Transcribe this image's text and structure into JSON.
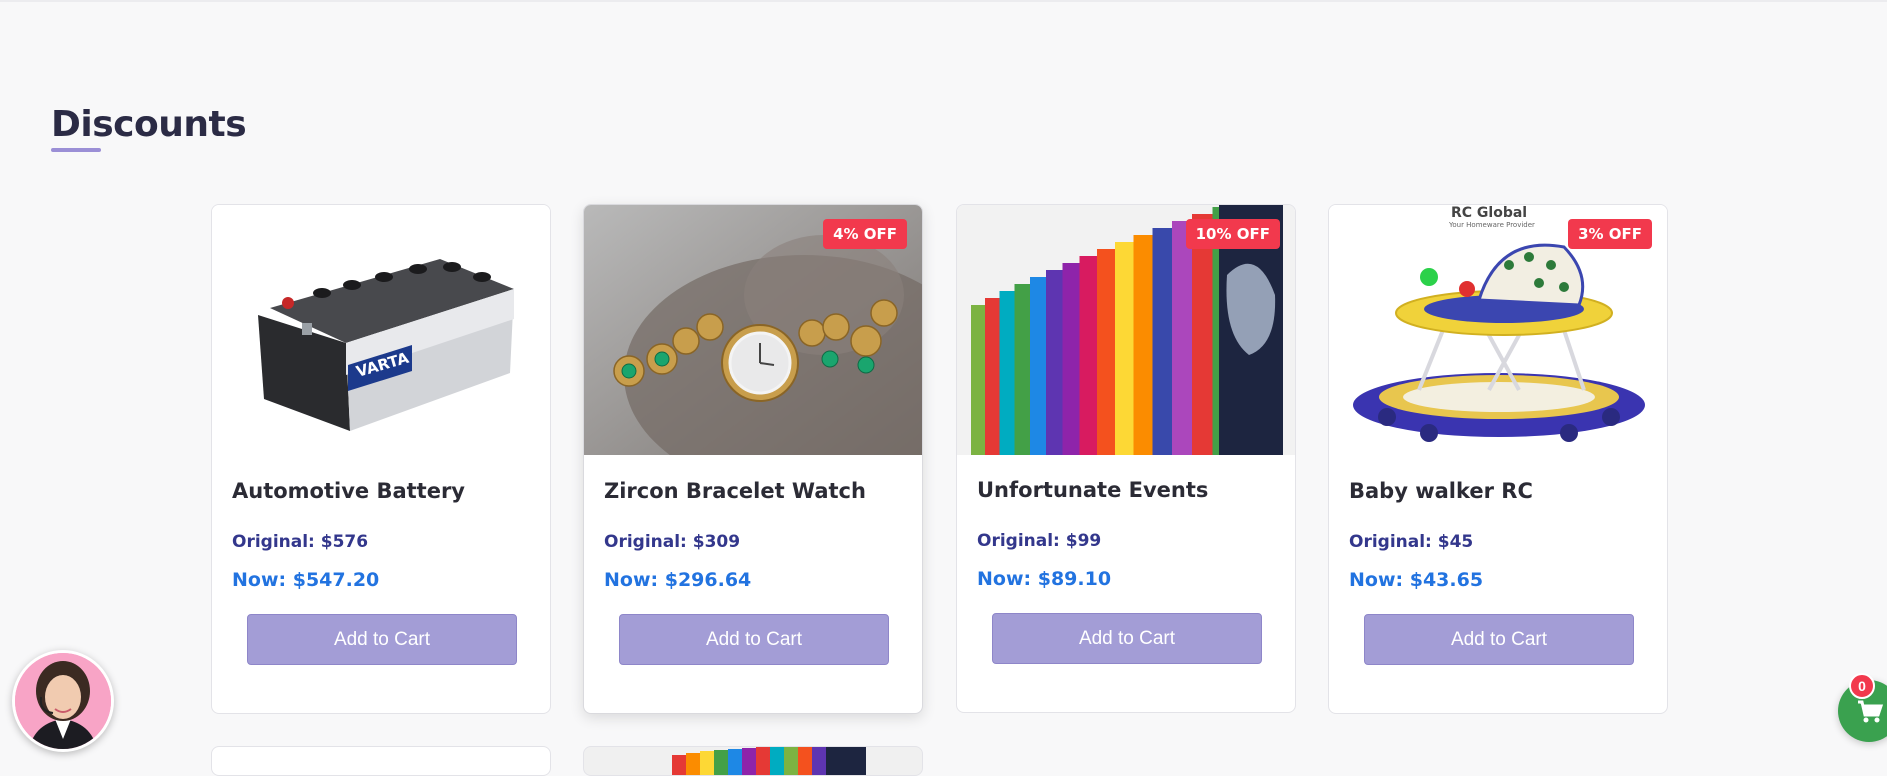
{
  "section": {
    "title": "Discounts"
  },
  "products": [
    {
      "name": "Automotive Battery",
      "original": "Original: $576",
      "now": "Now: $547.20",
      "badge": "",
      "button": "Add to Cart",
      "image_icon": "car-battery-icon"
    },
    {
      "name": "Zircon Bracelet Watch",
      "original": "Original: $309",
      "now": "Now: $296.64",
      "badge": "4% OFF",
      "button": "Add to Cart",
      "image_icon": "bracelet-watch-icon"
    },
    {
      "name": "Unfortunate Events",
      "original": "Original: $99",
      "now": "Now: $89.10",
      "badge": "10% OFF",
      "button": "Add to Cart",
      "image_icon": "book-set-icon"
    },
    {
      "name": "Baby walker RC",
      "original": "Original: $45",
      "now": "Now: $43.65",
      "badge": "3% OFF",
      "button": "Add to Cart",
      "image_icon": "baby-walker-icon"
    }
  ],
  "product_images": {
    "battery_brand": "VARTA",
    "walker_brand": "RC Global",
    "walker_tagline": "Your Homeware Provider"
  },
  "cart": {
    "count": "0",
    "icon": "cart-icon"
  },
  "support": {
    "icon": "support-agent-avatar"
  },
  "colors": {
    "accent": "#a39dd6",
    "badge": "#f2394d",
    "price_now": "#2273e0",
    "price_original": "#33378c",
    "cart_fab": "#3aa14f"
  }
}
